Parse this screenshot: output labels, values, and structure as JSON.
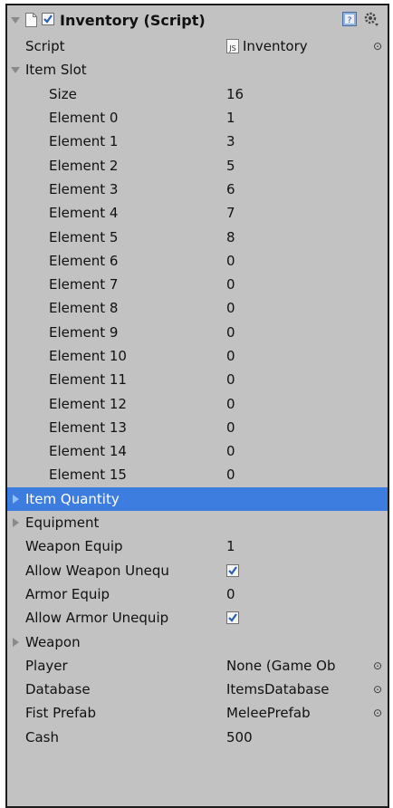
{
  "component": {
    "title": "Inventory (Script)",
    "enabled": true,
    "icon_names": [
      "foldout-arrow-icon",
      "script-file-icon",
      "enabled-checkbox",
      "help-book-icon",
      "gear-icon"
    ]
  },
  "script_field": {
    "label": "Script",
    "value": "Inventory",
    "file_badge": "JS"
  },
  "item_slot": {
    "label": "Item Slot",
    "size_label": "Size",
    "size_value": "16",
    "elements": [
      {
        "label": "Element 0",
        "value": "1"
      },
      {
        "label": "Element 1",
        "value": "3"
      },
      {
        "label": "Element 2",
        "value": "5"
      },
      {
        "label": "Element 3",
        "value": "6"
      },
      {
        "label": "Element 4",
        "value": "7"
      },
      {
        "label": "Element 5",
        "value": "8"
      },
      {
        "label": "Element 6",
        "value": "0"
      },
      {
        "label": "Element 7",
        "value": "0"
      },
      {
        "label": "Element 8",
        "value": "0"
      },
      {
        "label": "Element 9",
        "value": "0"
      },
      {
        "label": "Element 10",
        "value": "0"
      },
      {
        "label": "Element 11",
        "value": "0"
      },
      {
        "label": "Element 12",
        "value": "0"
      },
      {
        "label": "Element 13",
        "value": "0"
      },
      {
        "label": "Element 14",
        "value": "0"
      },
      {
        "label": "Element 15",
        "value": "0"
      }
    ]
  },
  "item_quantity": {
    "label": "Item Quantity",
    "selected": true
  },
  "equipment": {
    "label": "Equipment"
  },
  "weapon_equip": {
    "label": "Weapon Equip",
    "value": "1"
  },
  "allow_weapon_unequip": {
    "label": "Allow Weapon Unequ",
    "checked": true
  },
  "armor_equip": {
    "label": "Armor Equip",
    "value": "0"
  },
  "allow_armor_unequip": {
    "label": "Allow Armor Unequip",
    "checked": true
  },
  "weapon": {
    "label": "Weapon"
  },
  "player": {
    "label": "Player",
    "value": "None (Game Ob"
  },
  "database": {
    "label": "Database",
    "value": "ItemsDatabase"
  },
  "fist_prefab": {
    "label": "Fist Prefab",
    "value": "MeleePrefab"
  },
  "cash": {
    "label": "Cash",
    "value": "500"
  },
  "colors": {
    "panel_bg": "#c2c2c2",
    "selection": "#3e7de0",
    "border": "#1c1c1c"
  }
}
